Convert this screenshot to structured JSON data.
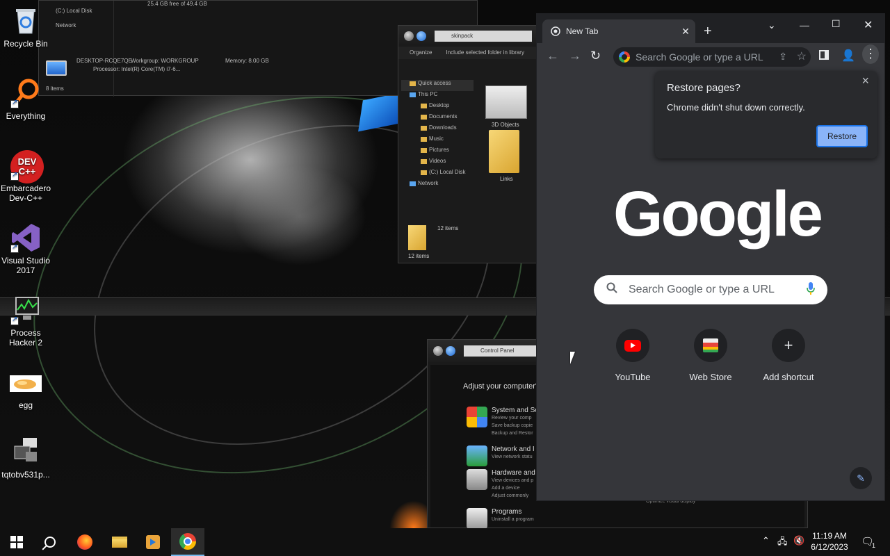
{
  "desktop_icons": [
    {
      "label": "Recycle Bin",
      "icon": "recycle-bin-icon"
    },
    {
      "label": "Everything",
      "icon": "everything-icon"
    },
    {
      "label": "Embarcadero Dev-C++",
      "icon": "devcpp-icon",
      "icon_text": "DEV C++"
    },
    {
      "label": "Visual Studio 2017",
      "icon": "visual-studio-icon"
    },
    {
      "label": "Process Hacker 2",
      "icon": "process-hacker-icon"
    },
    {
      "label": "egg",
      "icon": "egg-image-icon"
    },
    {
      "label": "tqtobv531p...",
      "icon": "file-icon"
    }
  ],
  "system_window": {
    "drive_free": "25.4 GB free of 49.4 GB",
    "nav_local_disk": "(C:) Local Disk",
    "nav_network": "Network",
    "computer_name": "DESKTOP-RCQE7QE",
    "workgroup": "Workgroup: WORKGROUP",
    "memory": "Memory: 8.00 GB",
    "processor": "Processor: Intel(R) Core(TM) i7-6...",
    "items": "8 items"
  },
  "explorer_window": {
    "address": "skinpack",
    "organize": "Organize",
    "include_library": "Include selected folder in library",
    "nav": [
      {
        "label": "Quick access",
        "level": 0,
        "selected": true
      },
      {
        "label": "This PC",
        "level": 0,
        "selected": false
      },
      {
        "label": "Desktop",
        "level": 1
      },
      {
        "label": "Documents",
        "level": 1
      },
      {
        "label": "Downloads",
        "level": 1
      },
      {
        "label": "Music",
        "level": 1
      },
      {
        "label": "Pictures",
        "level": 1
      },
      {
        "label": "Videos",
        "level": 1
      },
      {
        "label": "(C:) Local Disk",
        "level": 1
      },
      {
        "label": "Network",
        "level": 0
      }
    ],
    "files": [
      "3D Objects",
      "Links"
    ],
    "item_count": "12 items",
    "status": "12 items"
  },
  "control_panel": {
    "address": "Control Panel",
    "heading": "Adjust your computer's",
    "sections": [
      {
        "title": "System and Se",
        "lines": [
          "Review your comp",
          "Save backup copie",
          "Backup and Restor"
        ]
      },
      {
        "title": "Network and I",
        "lines": [
          "View network statu"
        ]
      },
      {
        "title": "Hardware and",
        "lines": [
          "View devices and p",
          "Add a device",
          "Adjust commonly"
        ]
      },
      {
        "title": "Programs",
        "lines": [
          "Uninstall a program"
        ]
      }
    ],
    "right_hint": "Optimize visual display"
  },
  "chrome": {
    "tab_title": "New Tab",
    "omnibox_placeholder": "Search Google or type a URL",
    "restore": {
      "title": "Restore pages?",
      "message": "Chrome didn't shut down correctly.",
      "button": "Restore"
    },
    "logo": "Google",
    "search_placeholder": "Search Google or type a URL",
    "shortcuts": [
      {
        "label": "YouTube",
        "icon": "youtube-icon"
      },
      {
        "label": "Web Store",
        "icon": "web-store-icon"
      },
      {
        "label": "Add shortcut",
        "icon": "plus-icon"
      }
    ]
  },
  "taskbar": {
    "apps": [
      "start-icon",
      "search-icon",
      "firefox-icon",
      "file-explorer-icon",
      "media-player-icon",
      "chrome-icon"
    ],
    "active_app": "chrome-icon",
    "time": "11:19 AM",
    "date": "6/12/2023",
    "notification_count": "1"
  }
}
